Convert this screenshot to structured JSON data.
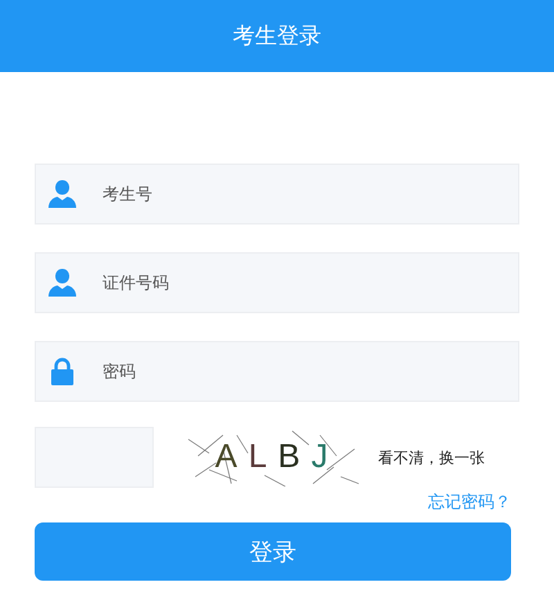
{
  "header": {
    "title": "考生登录"
  },
  "fields": [
    {
      "kind": "user",
      "placeholder": "考生号"
    },
    {
      "kind": "user",
      "placeholder": "证件号码"
    },
    {
      "kind": "lock",
      "placeholder": "密码"
    }
  ],
  "captcha": {
    "letters": [
      {
        "text": "A",
        "color": "#4a4a2a"
      },
      {
        "text": "L",
        "color": "#5a3a3a"
      },
      {
        "text": "B",
        "color": "#2a3020"
      },
      {
        "text": "J",
        "color": "#2a7a6a"
      }
    ],
    "refresh": "看不清，换一张"
  },
  "forgot_link": "忘记密码？",
  "login_button": "登录"
}
